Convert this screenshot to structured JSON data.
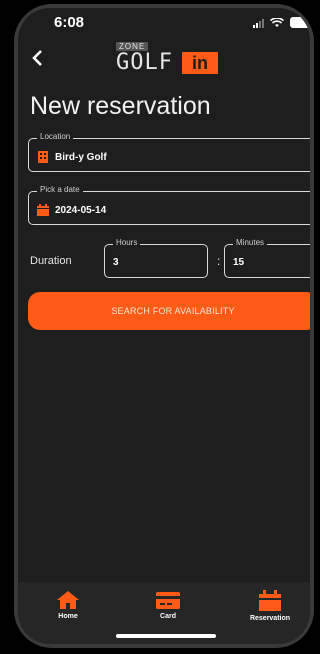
{
  "status": {
    "time": "6:08"
  },
  "header": {
    "logo_zone": "ZONE",
    "logo_golf": "GOLF",
    "logo_in": "in"
  },
  "title": "New reservation",
  "form": {
    "location": {
      "label": "Location",
      "value": "Bird-y Golf"
    },
    "date": {
      "label": "Pick a date",
      "value": "2024-05-14"
    },
    "duration_label": "Duration",
    "hours": {
      "label": "Hours",
      "value": "3"
    },
    "separator": ":",
    "minutes": {
      "label": "Minutes",
      "value": "15"
    },
    "search_label": "SEARCH FOR AVAILABILITY"
  },
  "colors": {
    "accent": "#ff5a16",
    "background": "#1e1e1e"
  },
  "tabs": [
    {
      "label": "Home",
      "icon": "home-icon"
    },
    {
      "label": "Card",
      "icon": "card-icon"
    },
    {
      "label": "Reservation",
      "icon": "calendar-icon"
    }
  ]
}
